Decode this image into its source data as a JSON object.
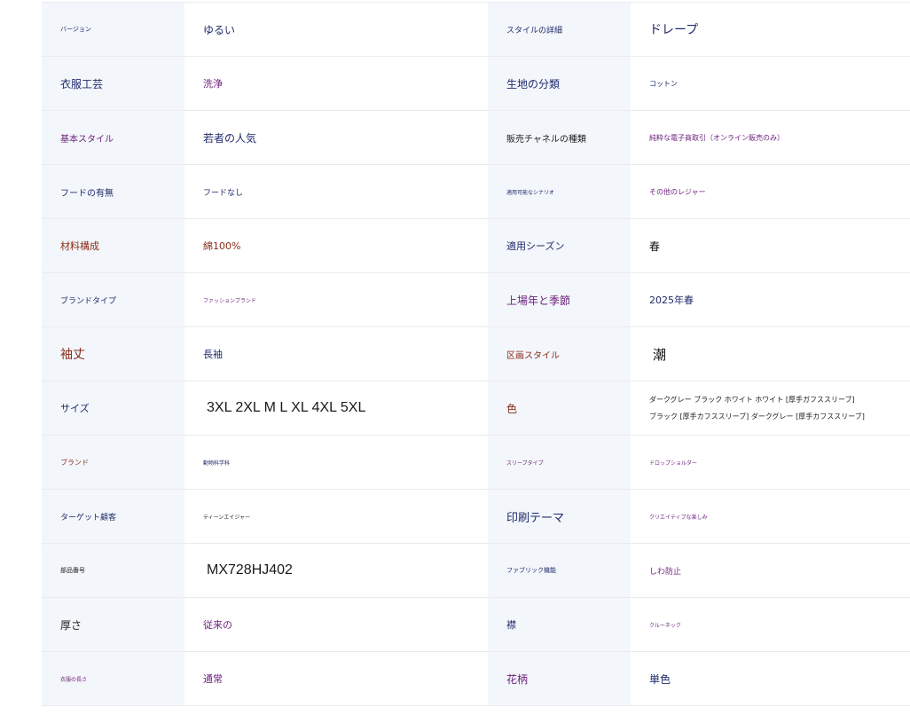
{
  "rows": [
    {
      "k1": "バージョン",
      "v1": "ゆるい",
      "k2": "スタイルの詳細",
      "v2": "ドレープ"
    },
    {
      "k1": "衣服工芸",
      "v1": "洗浄",
      "k2": "生地の分類",
      "v2": "コットン"
    },
    {
      "k1": "基本スタイル",
      "v1": "若者の人気",
      "k2": "販売チャネルの種類",
      "v2": "純粋な電子商取引（オンライン販売のみ）"
    },
    {
      "k1": "フードの有無",
      "v1": "フードなし",
      "k2": "適用可能なシナリオ",
      "v2": "その他のレジャー"
    },
    {
      "k1": "材料構成",
      "v1": "綿100%",
      "k2": "適用シーズン",
      "v2": "春"
    },
    {
      "k1": "ブランドタイプ",
      "v1": "ファッションブランド",
      "k2": "上場年と季節",
      "v2": "2025年春"
    },
    {
      "k1": "袖丈",
      "v1": "長袖",
      "k2": "区画スタイル",
      "v2": "潮"
    },
    {
      "k1": "サイズ",
      "v1": "3XL 2XL M L XL 4XL 5XL",
      "k2": "色",
      "v2_line1": "ダークグレー ブラック ホワイト ホワイト [厚手ガフススリーブ]",
      "v2_line2": "ブラック [厚手カフススリーブ] ダークグレー [厚手カフススリーブ]"
    },
    {
      "k1": "ブランド",
      "v1": "動物科学科",
      "k2": "スリーブタイプ",
      "v2": "ドロップショルダー"
    },
    {
      "k1": "ターゲット顧客",
      "v1": "ティーンエイジャー",
      "k2": "印刷テーマ",
      "v2": "クリエイティブな楽しみ"
    },
    {
      "k1": "部品番号",
      "v1": "MX728HJ402",
      "k2": "ファブリック機能",
      "v2": "しわ防止"
    },
    {
      "k1": "厚さ",
      "v1": "従来の",
      "k2": "襟",
      "v2": "クルーネック"
    },
    {
      "k1": "衣服の長さ",
      "v1": "通常",
      "k2": "花柄",
      "v2": "単色"
    }
  ]
}
